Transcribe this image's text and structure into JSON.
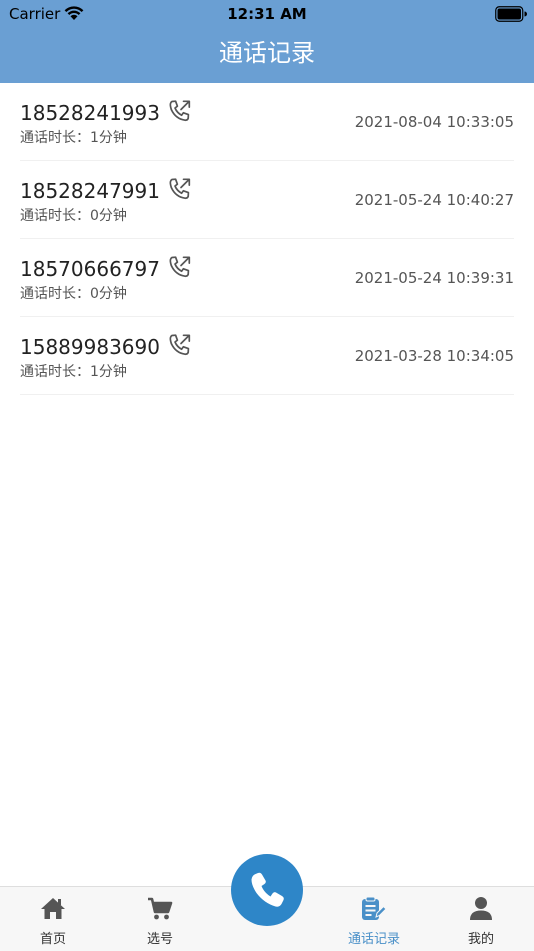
{
  "status_bar": {
    "carrier": "Carrier",
    "time": "12:31 AM"
  },
  "header": {
    "title": "通话记录"
  },
  "calls": [
    {
      "number": "18528241993",
      "duration": "通话时长：1分钟",
      "datetime": "2021-08-04 10:33:05"
    },
    {
      "number": "18528247991",
      "duration": "通话时长：0分钟",
      "datetime": "2021-05-24 10:40:27"
    },
    {
      "number": "18570666797",
      "duration": "通话时长：0分钟",
      "datetime": "2021-05-24 10:39:31"
    },
    {
      "number": "15889983690",
      "duration": "通话时长：1分钟",
      "datetime": "2021-03-28 10:34:05"
    }
  ],
  "tab_bar": {
    "home": "首页",
    "select_number": "选号",
    "call_log": "通话记录",
    "profile": "我的"
  },
  "colors": {
    "primary": "#6a9fd3",
    "dial_button": "#2e86c8",
    "active_tab": "#4a90c8"
  },
  "icons": {
    "call_item": "outgoing-call-icon",
    "home": "home-icon",
    "select_number": "cart-icon",
    "dial": "phone-icon",
    "call_log": "notepad-icon",
    "profile": "user-icon"
  }
}
